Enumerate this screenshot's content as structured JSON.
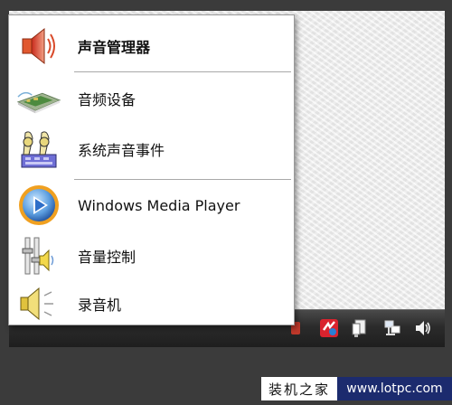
{
  "menu": {
    "items": [
      {
        "label": "声音管理器",
        "icon": "speaker-icon",
        "bold": true
      },
      {
        "label": "音频设备",
        "icon": "audio-device-icon",
        "bold": false
      },
      {
        "label": "系统声音事件",
        "icon": "sound-events-icon",
        "bold": false
      },
      {
        "label": "Windows Media Player",
        "icon": "media-player-icon",
        "bold": false
      },
      {
        "label": "音量控制",
        "icon": "volume-control-icon",
        "bold": false
      },
      {
        "label": "录音机",
        "icon": "sound-recorder-icon",
        "bold": false
      }
    ]
  },
  "tray": {
    "icons": [
      "antivirus-icon",
      "usb-device-icon",
      "network-icon",
      "volume-icon"
    ]
  },
  "watermark": {
    "left_text": "装机之家",
    "right_text": "www.lotpc.com"
  },
  "colors": {
    "watermark_bg": "#1c2b6e",
    "taskbar": "#2b2b2b",
    "menu_bg": "#ffffff"
  }
}
